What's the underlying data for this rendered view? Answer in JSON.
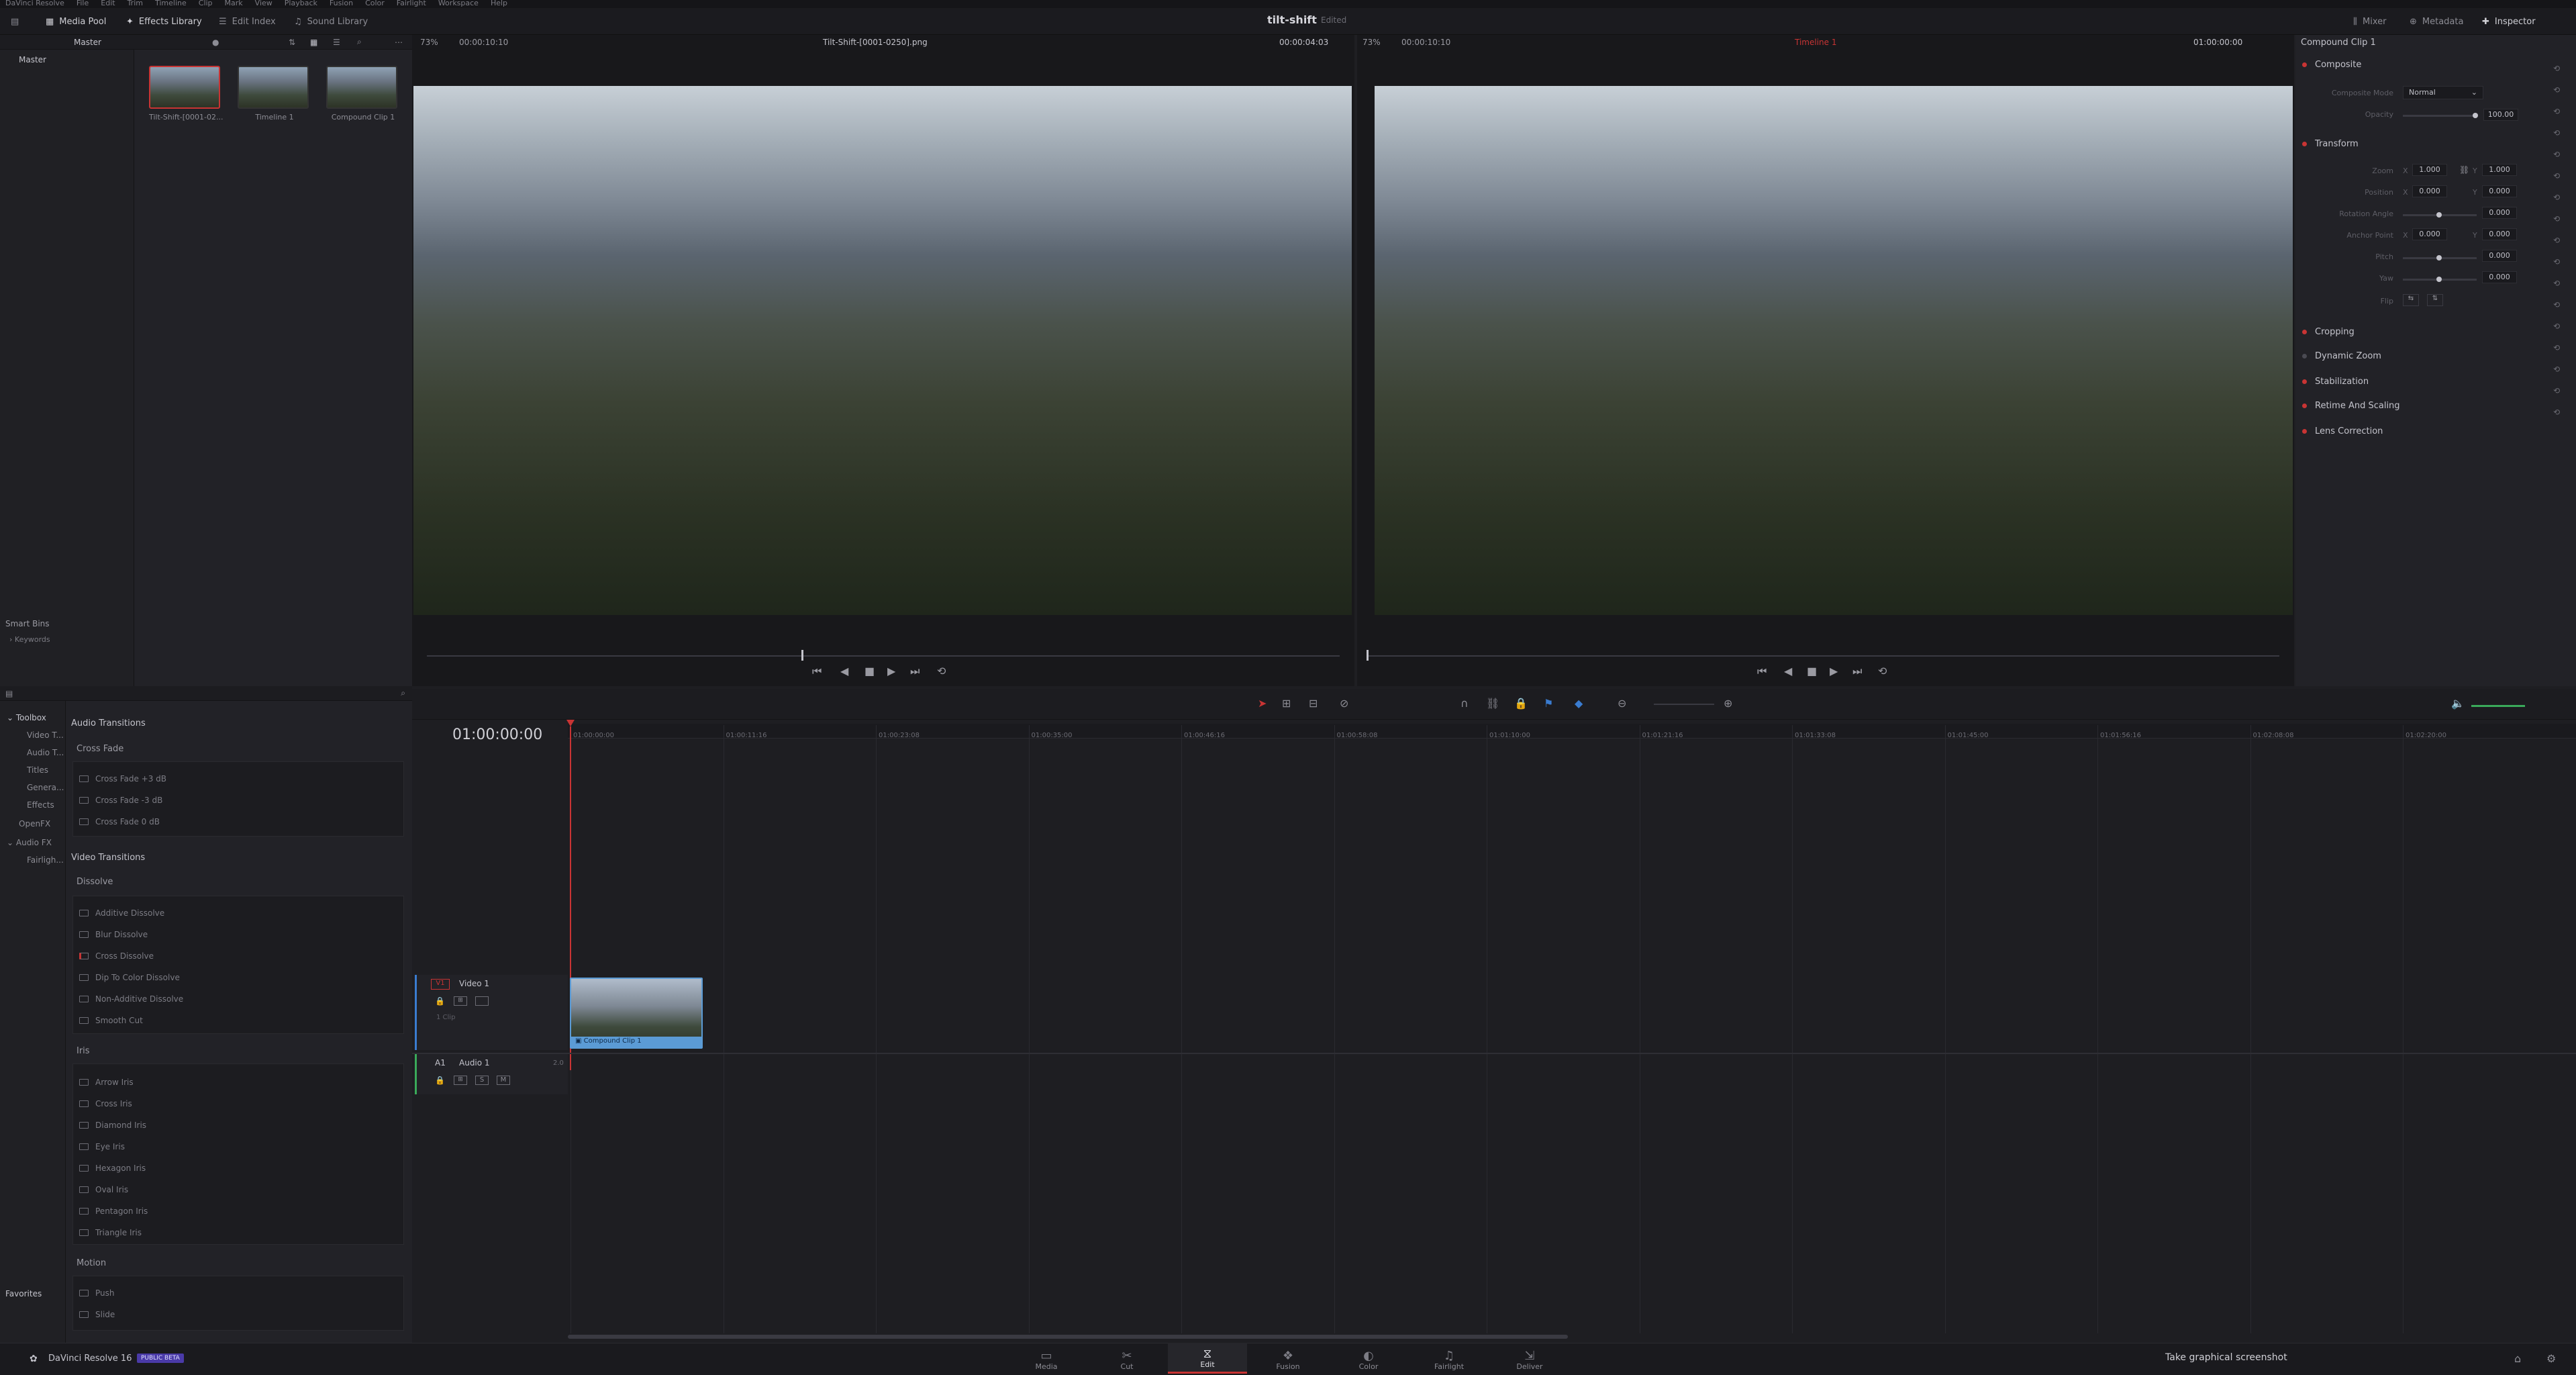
{
  "menu": [
    "DaVinci Resolve",
    "File",
    "Edit",
    "Trim",
    "Timeline",
    "Clip",
    "Mark",
    "View",
    "Playback",
    "Fusion",
    "Color",
    "Fairlight",
    "Workspace",
    "Help"
  ],
  "topbar": {
    "media_pool": "Media Pool",
    "effects_library": "Effects Library",
    "edit_index": "Edit Index",
    "sound_library": "Sound Library",
    "project_title": "tilt-shift",
    "project_status": "Edited",
    "mixer": "Mixer",
    "metadata": "Metadata",
    "inspector": "Inspector"
  },
  "media_pool": {
    "bin": "Master",
    "root": "Master",
    "clips": [
      {
        "name": "Tilt-Shift-[0001-02..."
      },
      {
        "name": "Timeline 1"
      },
      {
        "name": "Compound Clip 1"
      }
    ],
    "smart_bins": "Smart Bins",
    "keywords": "Keywords"
  },
  "source_viewer": {
    "zoom": "73%",
    "timecode_left": "00:00:10:10",
    "clip_name": "Tilt-Shift-[0001-0250].png",
    "timecode_right": "00:00:04:03",
    "playhead_fraction": 0.41
  },
  "timeline_viewer": {
    "zoom": "73%",
    "timecode_left": "00:00:10:10",
    "timeline_name": "Timeline 1",
    "timecode_right": "01:00:00:00"
  },
  "inspector": {
    "title": "Compound Clip 1",
    "composite": {
      "section": "Composite",
      "mode_label": "Composite Mode",
      "mode_value": "Normal",
      "opacity_label": "Opacity",
      "opacity_value": "100.00"
    },
    "transform": {
      "section": "Transform",
      "zoom_label": "Zoom",
      "zoom_x": "1.000",
      "zoom_y": "1.000",
      "position_label": "Position",
      "position_x": "0.000",
      "position_y": "0.000",
      "rotation_label": "Rotation Angle",
      "rotation_value": "0.000",
      "anchor_label": "Anchor Point",
      "anchor_x": "0.000",
      "anchor_y": "0.000",
      "pitch_label": "Pitch",
      "pitch_value": "0.000",
      "yaw_label": "Yaw",
      "yaw_value": "0.000",
      "flip_label": "Flip",
      "x": "X",
      "y": "Y"
    },
    "sections": [
      "Cropping",
      "Dynamic Zoom",
      "Stabilization",
      "Retime And Scaling",
      "Lens Correction"
    ]
  },
  "toolbox": {
    "root": "Toolbox",
    "items": [
      "Video T...",
      "Audio T...",
      "Titles",
      "Genera...",
      "Effects"
    ],
    "openfx": "OpenFX",
    "audio_fx": "Audio FX",
    "fairlight": "Fairligh...",
    "favorites": "Favorites"
  },
  "effects": {
    "audio_transitions": "Audio Transitions",
    "cross_fade": "Cross Fade",
    "audio_items": [
      "Cross Fade +3 dB",
      "Cross Fade -3 dB",
      "Cross Fade 0 dB"
    ],
    "video_transitions": "Video Transitions",
    "dissolve": "Dissolve",
    "dissolve_items": [
      "Additive Dissolve",
      "Blur Dissolve",
      "Cross Dissolve",
      "Dip To Color Dissolve",
      "Non-Additive Dissolve",
      "Smooth Cut"
    ],
    "iris": "Iris",
    "iris_items": [
      "Arrow Iris",
      "Cross Iris",
      "Diamond Iris",
      "Eye Iris",
      "Hexagon Iris",
      "Oval Iris",
      "Pentagon Iris",
      "Triangle Iris"
    ],
    "motion": "Motion",
    "motion_items": [
      "Push",
      "Slide"
    ]
  },
  "timeline": {
    "timecode": "01:00:00:00",
    "ticks": [
      "01:00:00:00",
      "01:00:11:16",
      "01:00:23:08",
      "01:00:35:00",
      "01:00:46:16",
      "01:00:58:08",
      "01:01:10:00",
      "01:01:21:16",
      "01:01:33:08",
      "01:01:45:00",
      "01:01:56:16",
      "01:02:08:08",
      "01:02:20:00"
    ],
    "video_track_id": "V1",
    "video_track_name": "Video 1",
    "clip_count": "1 Clip",
    "audio_track_id": "A1",
    "audio_track_name": "Audio 1",
    "audio_channels": "2.0",
    "solo": "S",
    "mute": "M",
    "clip_name": "Compound Clip 1"
  },
  "footer": {
    "app_name": "DaVinci Resolve 16",
    "badge": "PUBLIC BETA",
    "pages": [
      "Media",
      "Cut",
      "Edit",
      "Fusion",
      "Color",
      "Fairlight",
      "Deliver"
    ],
    "active_page": "Edit",
    "screenshot_button": "Take graphical screenshot"
  },
  "colors": {
    "accent": "#c83434",
    "clip_blue": "#5b9bd5",
    "audio_green": "#3aaa5a"
  }
}
